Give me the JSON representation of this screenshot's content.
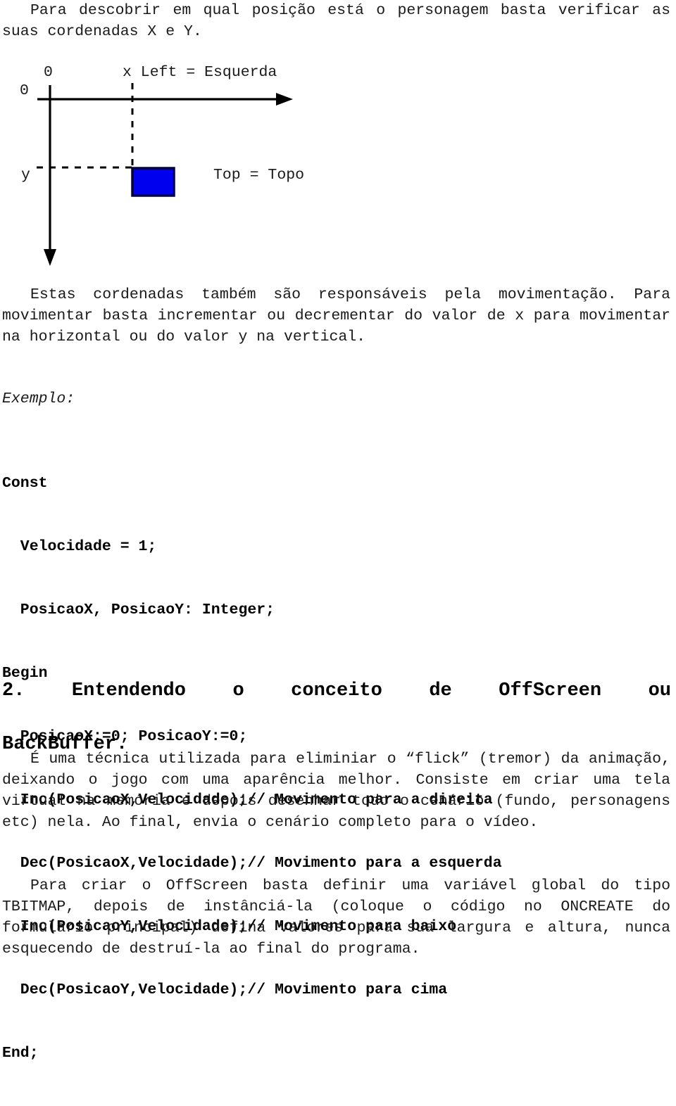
{
  "document": {
    "paragraphs_top": [
      "Para descobrir em qual posição está o personagem basta verificar as suas cordenadas X e Y."
    ],
    "diagram": {
      "label_x_axis_zero": "0",
      "label_y_axis_zero": "0",
      "label_x": "x",
      "label_y": "y",
      "label_left": "Left = Esquerda",
      "label_x_full": "x Left = Esquerda",
      "label_top": "Top = Topo",
      "sprite_color": "#0000EE",
      "sprite_border_color": "#000066",
      "axis_color": "#000000"
    },
    "paragraphs_mid": [
      "Estas cordenadas também são responsáveis pela movimentação. Para movimentar basta incrementar ou decrementar do valor de x para movimentar na horizontal ou do valor y na vertical."
    ],
    "example_label": "Exemplo:",
    "code_lines": [
      "Const",
      "  Velocidade = 1;",
      "  PosicaoX, PosicaoY: Integer;",
      "Begin",
      "  PosicaoX:=0; PosicaoY:=0;",
      "  Inc(PosicaoX,Velocidade);// Movimento para a direita",
      "  Dec(PosicaoX,Velocidade);// Movimento para a esquerda",
      "  Inc(PosicaoY,Velocidade);// Movimento para baixo",
      "  Dec(PosicaoY,Velocidade);// Movimento para cima",
      "End;"
    ],
    "heading": {
      "line1": "2. Entendendo o conceito de OffScreen ou",
      "line2": "BackBuffer.",
      "full": "2. Entendendo o conceito de OffScreen ou BackBuffer."
    },
    "paragraphs_bottom": [
      "É uma técnica utilizada para eliminiar o “flick” (tremor) da animação, deixando o jogo com uma aparência melhor. Consiste em criar uma tela virtual na memória e depois desenhar todo o cenário (fundo, personagens etc) nela. Ao final, envia o cenário completo para o vídeo.",
      "Para criar o OffScreen basta definir uma variável global do tipo TBITMAP, depois de instânciá-la (coloque o código no ONCREATE do formulário principal) defina valores para sua largura e altura, nunca esquecendo de destruí-la ao final do programa."
    ]
  }
}
